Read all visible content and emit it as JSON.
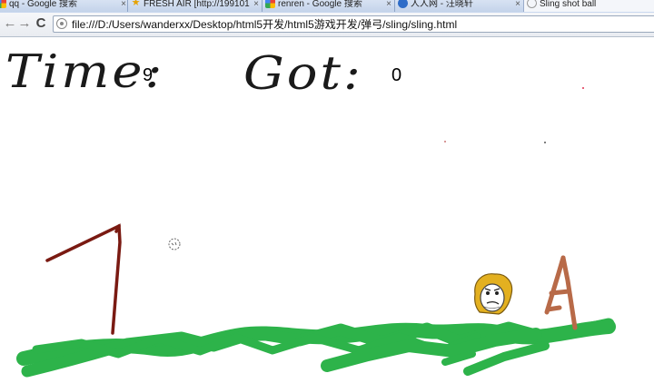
{
  "browser": {
    "tabs": [
      {
        "title": "qq - Google 搜索",
        "favicon": "google-icon",
        "active": false
      },
      {
        "title": "FRESH AIR [http://199101",
        "favicon": "star-icon",
        "active": false
      },
      {
        "title": "renren - Google 搜索",
        "favicon": "google-icon",
        "active": false
      },
      {
        "title": "人人网 - 汪晓轩",
        "favicon": "renren-icon",
        "active": false
      },
      {
        "title": "Sling shot ball",
        "favicon": "sling-page-icon",
        "active": true
      }
    ],
    "close_glyph": "×",
    "back_glyph": "←",
    "forward_glyph": "→",
    "reload_glyph": "C",
    "url": "file:///D:/Users/wanderxx/Desktop/html5开发/html5游戏开发/弹弓/sling/sling.html"
  },
  "game": {
    "time_label": "Time:",
    "time_value": "9",
    "got_label": "Got:",
    "got_value": "0",
    "colors": {
      "ground": "#2db34a",
      "slingshot": "#7a1a12",
      "target_stand": "#b86a48",
      "face_hair": "#e3b020",
      "label_ink": "#1a1a1a"
    }
  }
}
